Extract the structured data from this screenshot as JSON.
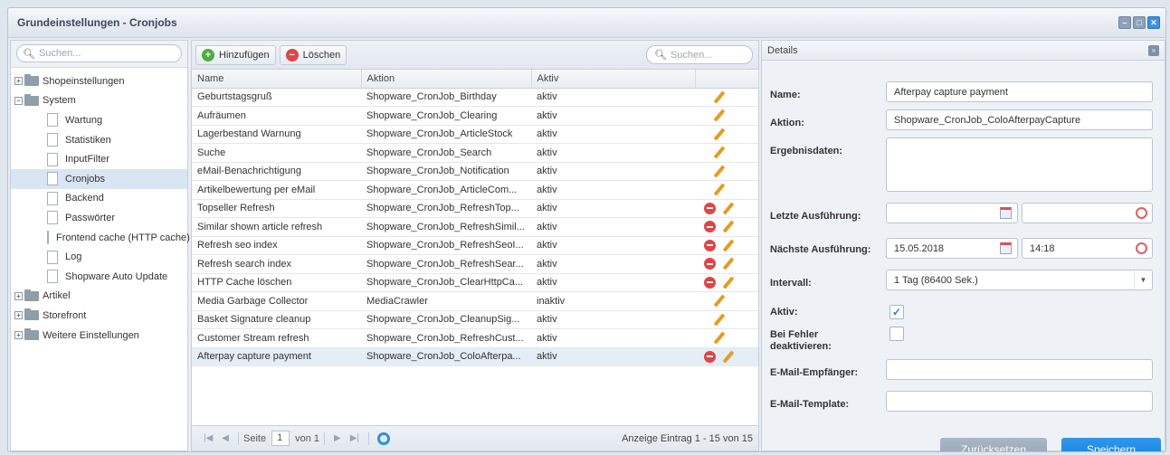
{
  "window": {
    "title": "Grundeinstellungen - Cronjobs"
  },
  "tree": {
    "search_placeholder": "Suchen...",
    "nodes": [
      {
        "label": "Shopeinstellungen",
        "type": "folder",
        "expander": "+"
      },
      {
        "label": "System",
        "type": "folder",
        "expander": "−"
      },
      {
        "label": "Wartung",
        "type": "doc"
      },
      {
        "label": "Statistiken",
        "type": "doc"
      },
      {
        "label": "InputFilter",
        "type": "doc"
      },
      {
        "label": "Cronjobs",
        "type": "doc",
        "selected": true
      },
      {
        "label": "Backend",
        "type": "doc"
      },
      {
        "label": "Passwörter",
        "type": "doc"
      },
      {
        "label": "Frontend cache (HTTP cache)",
        "type": "doc"
      },
      {
        "label": "Log",
        "type": "doc"
      },
      {
        "label": "Shopware Auto Update",
        "type": "doc"
      },
      {
        "label": "Artikel",
        "type": "folder",
        "expander": "+"
      },
      {
        "label": "Storefront",
        "type": "folder",
        "expander": "+"
      },
      {
        "label": "Weitere Einstellungen",
        "type": "folder",
        "expander": "+"
      }
    ]
  },
  "toolbar": {
    "add_label": "Hinzufügen",
    "delete_label": "Löschen",
    "search_placeholder": "Suchen..."
  },
  "grid": {
    "columns": [
      "Name",
      "Aktion",
      "Aktiv",
      ""
    ],
    "rows": [
      {
        "name": "Geburtstagsgruß",
        "action": "Shopware_CronJob_Birthday",
        "active": "aktiv",
        "deletable": false
      },
      {
        "name": "Aufräumen",
        "action": "Shopware_CronJob_Clearing",
        "active": "aktiv",
        "deletable": false
      },
      {
        "name": "Lagerbestand Warnung",
        "action": "Shopware_CronJob_ArticleStock",
        "active": "aktiv",
        "deletable": false
      },
      {
        "name": "Suche",
        "action": "Shopware_CronJob_Search",
        "active": "aktiv",
        "deletable": false
      },
      {
        "name": "eMail-Benachrichtigung",
        "action": "Shopware_CronJob_Notification",
        "active": "aktiv",
        "deletable": false
      },
      {
        "name": "Artikelbewertung per eMail",
        "action": "Shopware_CronJob_ArticleCom...",
        "active": "aktiv",
        "deletable": false
      },
      {
        "name": "Topseller Refresh",
        "action": "Shopware_CronJob_RefreshTop...",
        "active": "aktiv",
        "deletable": true
      },
      {
        "name": "Similar shown article refresh",
        "action": "Shopware_CronJob_RefreshSimil...",
        "active": "aktiv",
        "deletable": true
      },
      {
        "name": "Refresh seo index",
        "action": "Shopware_CronJob_RefreshSeoI...",
        "active": "aktiv",
        "deletable": true
      },
      {
        "name": "Refresh search index",
        "action": "Shopware_CronJob_RefreshSear...",
        "active": "aktiv",
        "deletable": true
      },
      {
        "name": "HTTP Cache löschen",
        "action": "Shopware_CronJob_ClearHttpCa...",
        "active": "aktiv",
        "deletable": true
      },
      {
        "name": "Media Garbage Collector",
        "action": "MediaCrawler",
        "active": "inaktiv",
        "deletable": false
      },
      {
        "name": "Basket Signature cleanup",
        "action": "Shopware_CronJob_CleanupSig...",
        "active": "aktiv",
        "deletable": false
      },
      {
        "name": "Customer Stream refresh",
        "action": "Shopware_CronJob_RefreshCust...",
        "active": "aktiv",
        "deletable": false
      },
      {
        "name": "Afterpay capture payment",
        "action": "Shopware_CronJob_ColoAfterpa...",
        "active": "aktiv",
        "deletable": true,
        "selected": true
      }
    ]
  },
  "pager": {
    "page_label": "Seite",
    "page_value": "1",
    "of_label": "von 1",
    "info": "Anzeige Eintrag 1 - 15 von 15"
  },
  "details": {
    "header": "Details",
    "name_label": "Name:",
    "name_value": "Afterpay capture payment",
    "action_label": "Aktion:",
    "action_value": "Shopware_CronJob_ColoAfterpayCapture",
    "result_label": "Ergebnisdaten:",
    "result_value": "",
    "last_label": "Letzte Ausführung:",
    "last_date": "",
    "last_time": "",
    "next_label": "Nächste Ausführung:",
    "next_date": "15.05.2018",
    "next_time": "14:18",
    "interval_label": "Intervall:",
    "interval_value": "1 Tag (86400 Sek.)",
    "active_label": "Aktiv:",
    "active_checked": true,
    "disable_label": "Bei Fehler deaktivieren:",
    "disable_checked": false,
    "email_label": "E-Mail-Empfänger:",
    "email_value": "",
    "template_label": "E-Mail-Template:",
    "template_value": "",
    "reset_label": "Zurücksetzen",
    "save_label": "Speichern"
  }
}
